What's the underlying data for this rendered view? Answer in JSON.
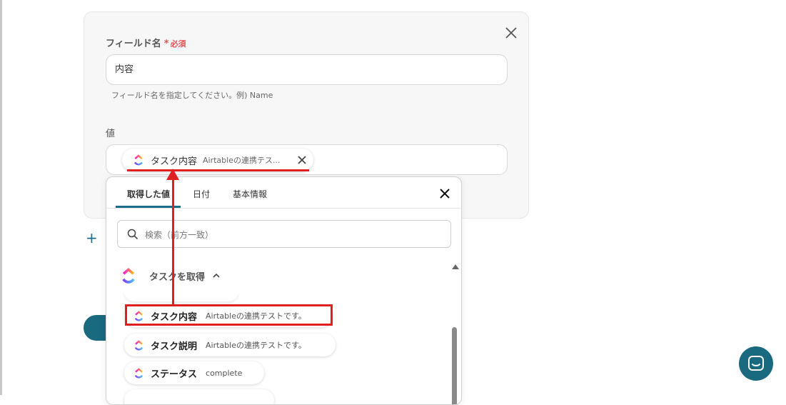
{
  "form": {
    "field_label": "フィールド名",
    "required_mark": "*",
    "required_text": "必須",
    "field_value": "内容",
    "field_hint": "フィールド名を指定してください。例) Name",
    "value_label": "値"
  },
  "selected_chip": {
    "title": "タスク内容",
    "subtitle": "Airtableの連携テス..."
  },
  "add_button": "+",
  "dropdown": {
    "tabs": [
      "取得した値",
      "日付",
      "基本情報"
    ],
    "active_tab": "取得した値",
    "search_placeholder": "検索（前方一致）",
    "group": {
      "title": "タスクを取得",
      "items": [
        {
          "title": "タスク内容",
          "subtitle": "Airtableの連携テストです。"
        },
        {
          "title": "タスク説明",
          "subtitle": "Airtableの連携テストです。"
        },
        {
          "title": "ステータス",
          "subtitle": "complete"
        }
      ]
    }
  },
  "colors": {
    "accent": "#1b6e8a",
    "required": "#e25555",
    "annotation": "#e02020",
    "chat_button": "#19697f"
  },
  "icons": [
    "close-icon",
    "clickup-icon",
    "search-icon",
    "chevron-up-icon",
    "chat-icon"
  ]
}
